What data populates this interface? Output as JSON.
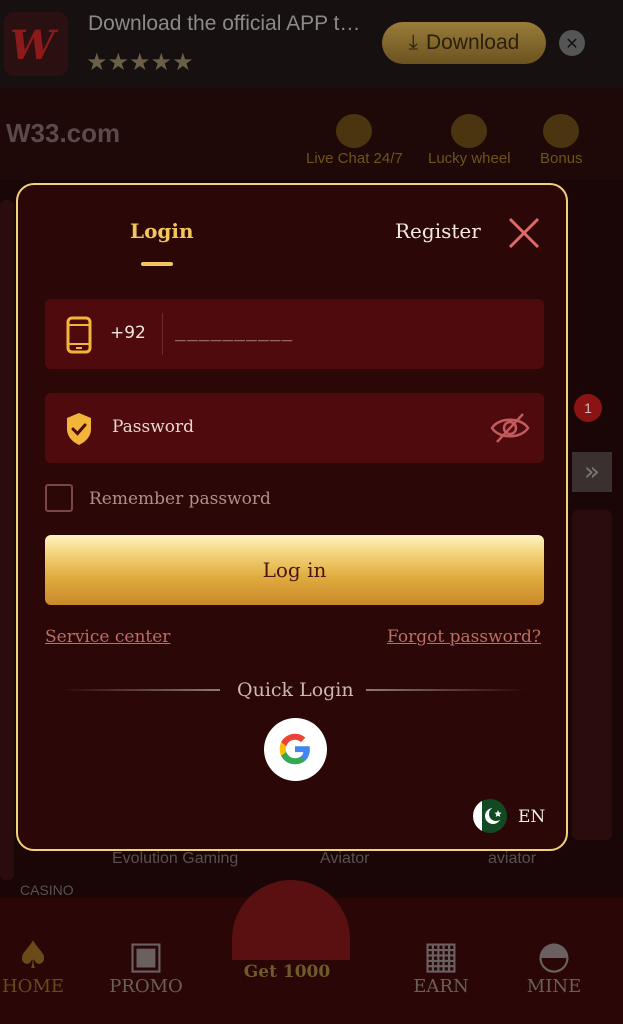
{
  "banner": {
    "logo_text": "W",
    "title": "Download the official APP t…",
    "stars": "★★★★★",
    "download_label": "Download",
    "close_symbol": "✕"
  },
  "topbar": {
    "brand": "W33.com",
    "items": [
      {
        "label": "Live Chat 24/7",
        "icon": "headset-icon"
      },
      {
        "label": "Lucky wheel",
        "icon": "wheel-icon"
      },
      {
        "label": "Bonus",
        "icon": "gift-icon"
      }
    ]
  },
  "background": {
    "labels": [
      "Evolution Gaming",
      "Aviator",
      "aviator",
      "CASINO"
    ],
    "badge_count": "1"
  },
  "modal": {
    "tabs": {
      "login": "Login",
      "register": "Register"
    },
    "phone": {
      "country_code": "+92",
      "placeholder": "__________"
    },
    "password": {
      "placeholder": "Password"
    },
    "remember_label": "Remember password",
    "login_button": "Log in",
    "service_center": "Service center",
    "forgot_password": "Forgot password?",
    "quick_login": "Quick Login",
    "language": "EN"
  },
  "bottom_nav": {
    "items": [
      {
        "label": "HOME",
        "icon": "spade-icon",
        "active": true
      },
      {
        "label": "PROMO",
        "icon": "coupon-icon",
        "active": false
      },
      {
        "label": "EARN",
        "icon": "gift-icon",
        "active": false
      },
      {
        "label": "MINE",
        "icon": "user-icon",
        "active": false
      }
    ],
    "center_label": "Get 1000"
  },
  "colors": {
    "accent_gold": "#f2c65a",
    "modal_bg": "#2b0708",
    "field_bg": "#4e0a0c",
    "link": "#bb6e62"
  }
}
